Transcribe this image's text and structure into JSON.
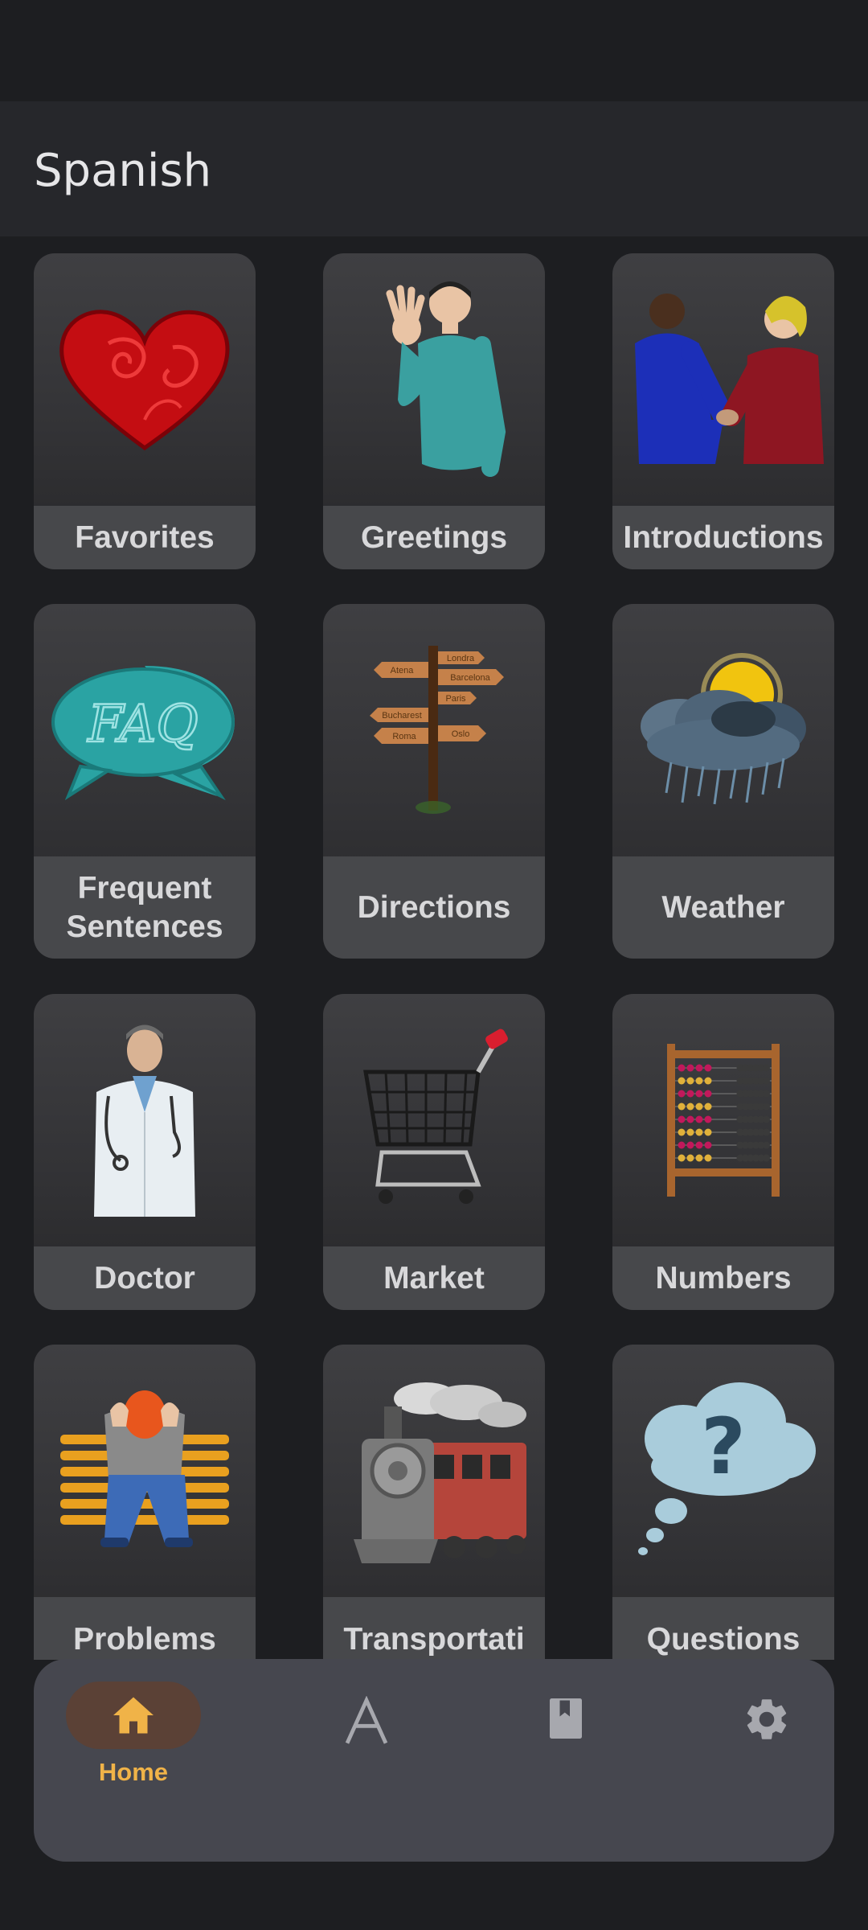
{
  "app": {
    "title": "Spanish"
  },
  "categories": [
    {
      "label": "Favorites",
      "icon": "heart-icon"
    },
    {
      "label": "Greetings",
      "icon": "waving-man-icon"
    },
    {
      "label": "Introductions",
      "icon": "handshake-icon"
    },
    {
      "label": "Frequent\nSentences",
      "icon": "faq-bubble-icon"
    },
    {
      "label": "Directions",
      "icon": "signpost-icon"
    },
    {
      "label": "Weather",
      "icon": "storm-cloud-icon"
    },
    {
      "label": "Doctor",
      "icon": "doctor-icon"
    },
    {
      "label": "Market",
      "icon": "shopping-cart-icon"
    },
    {
      "label": "Numbers",
      "icon": "abacus-icon"
    },
    {
      "label": "Problems",
      "icon": "troubled-man-icon"
    },
    {
      "label": "Transportati",
      "icon": "train-icon"
    },
    {
      "label": "Questions",
      "icon": "question-bubble-icon"
    }
  ],
  "nav": {
    "home_label": "Home",
    "items": [
      "home-icon",
      "alphabet-icon",
      "book-icon",
      "settings-icon"
    ]
  },
  "colors": {
    "accent": "#f0b348",
    "background": "#1d1e21",
    "nav_background": "#46474f"
  },
  "signpost": {
    "sign_1": "Atena",
    "sign_2": "Londra",
    "sign_3": "Barcelona",
    "sign_4": "Paris",
    "sign_5": "Bucharest",
    "sign_6": "Roma",
    "sign_7": "Oslo"
  },
  "faq": {
    "text": "FAQ"
  },
  "question": {
    "mark": "?"
  }
}
